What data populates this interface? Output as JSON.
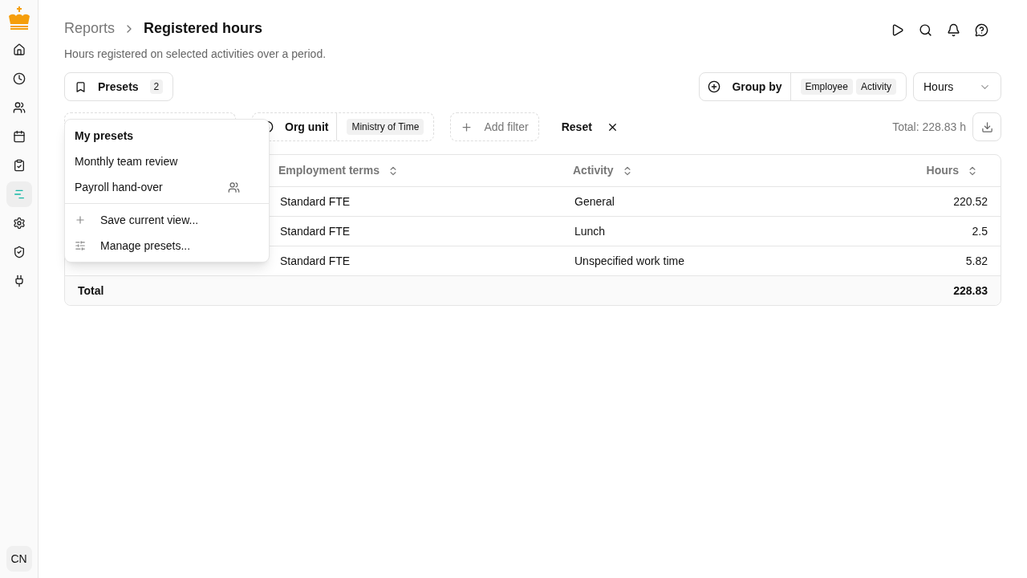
{
  "sidebar": {
    "items": [
      {
        "selected": false
      },
      {
        "selected": false
      },
      {
        "selected": false
      },
      {
        "selected": false
      },
      {
        "selected": false
      },
      {
        "selected": true
      },
      {
        "selected": false
      },
      {
        "selected": false
      },
      {
        "selected": false
      }
    ],
    "user_initials": "CN"
  },
  "breadcrumb": {
    "parent": "Reports",
    "current": "Registered hours"
  },
  "subtitle": "Hours registered on selected activities over a period.",
  "presets_button": {
    "label": "Presets",
    "count": "2"
  },
  "group_by": {
    "label": "Group by",
    "chips": [
      "Employee",
      "Activity"
    ]
  },
  "measure_select": {
    "value": "Hours"
  },
  "filters": [
    {
      "kind": "hidden"
    },
    {
      "kind": "filter",
      "label": "Org unit",
      "value": "Ministry of Time"
    }
  ],
  "add_filter": "Add filter",
  "reset": "Reset",
  "total": "Total: 228.83 h",
  "table": {
    "columns": [
      "Employment terms",
      "Activity",
      "Hours"
    ],
    "rows": [
      [
        "Standard FTE",
        "General",
        "220.52"
      ],
      [
        "Standard FTE",
        "Lunch",
        "2.5"
      ],
      [
        "Standard FTE",
        "Unspecified work time",
        "5.82"
      ]
    ],
    "footer": {
      "label": "Total",
      "value": "228.83"
    }
  },
  "presets_menu": {
    "heading": "My presets",
    "items": [
      {
        "label": "Monthly team review",
        "shared": false
      },
      {
        "label": "Payroll hand-over",
        "shared": true
      }
    ],
    "actions": [
      "Save current view...",
      "Manage presets..."
    ]
  }
}
